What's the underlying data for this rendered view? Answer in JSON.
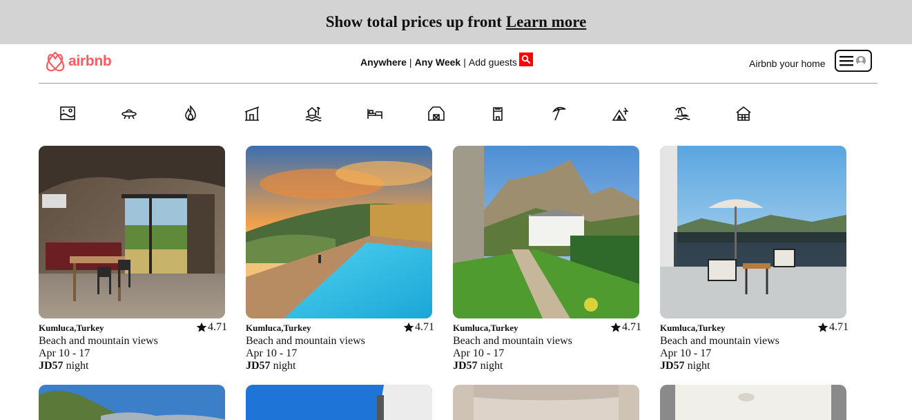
{
  "banner": {
    "text": "Show total prices up front",
    "link": "Learn more"
  },
  "header": {
    "logo_text": "airbnb",
    "search": {
      "where": "Anywhere",
      "sep1": "|",
      "when": "Any Week",
      "sep2": "|",
      "guests": "Add guests"
    },
    "host_link": "Airbnb your home"
  },
  "categories": [
    {
      "icon": "beachfront-icon"
    },
    {
      "icon": "omg-icon"
    },
    {
      "icon": "trending-icon"
    },
    {
      "icon": "design-icon"
    },
    {
      "icon": "lake-icon"
    },
    {
      "icon": "rooms-icon"
    },
    {
      "icon": "countryside-icon"
    },
    {
      "icon": "castle-icon"
    },
    {
      "icon": "beach-icon"
    },
    {
      "icon": "camping-icon"
    },
    {
      "icon": "island-icon"
    },
    {
      "icon": "cabin-icon"
    }
  ],
  "listings": [
    {
      "location": "Kumluca,Turkey",
      "rating": "4.71",
      "description": "Beach and mountain views",
      "dates": "Apr 10 - 17",
      "price": "JD57",
      "price_unit": " night"
    },
    {
      "location": "Kumluca,Turkey",
      "rating": "4.71",
      "description": "Beach and mountain views",
      "dates": "Apr 10 - 17",
      "price": "JD57",
      "price_unit": " night"
    },
    {
      "location": "Kumluca,Turkey",
      "rating": "4.71",
      "description": "Beach and mountain views",
      "dates": "Apr 10 - 17",
      "price": "JD57",
      "price_unit": " night"
    },
    {
      "location": "Kumluca,Turkey",
      "rating": "4.71",
      "description": "Beach and mountain views",
      "dates": "Apr 10 - 17",
      "price": "JD57",
      "price_unit": " night"
    }
  ],
  "colors": {
    "brand": "#ff5a5f",
    "search_button": "#ff0000",
    "banner_bg": "#d3d3d3"
  }
}
